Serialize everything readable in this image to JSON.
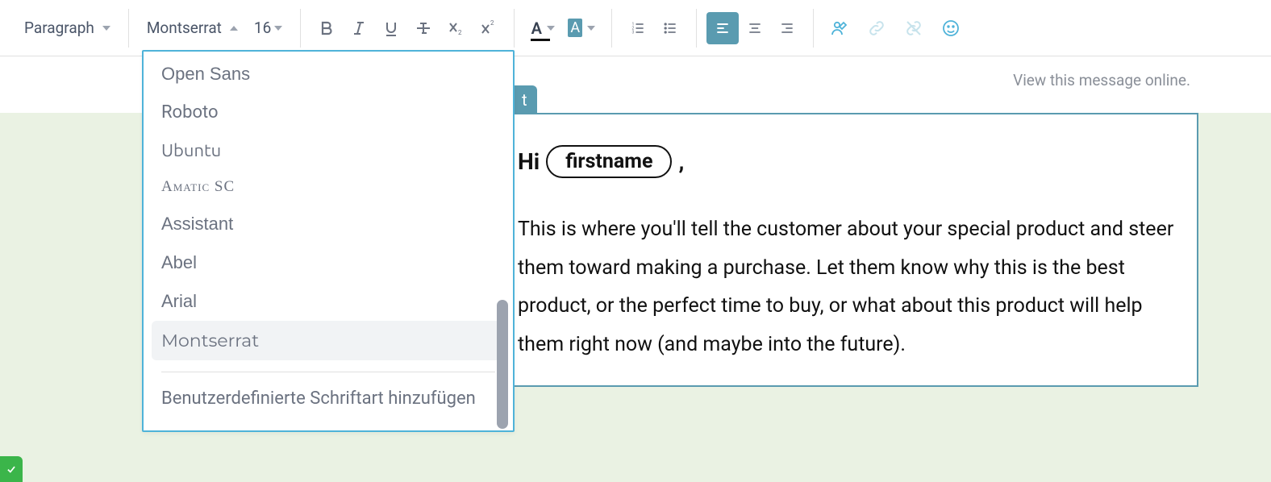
{
  "toolbar": {
    "paragraph": {
      "label": "Paragraph"
    },
    "font": {
      "label": "Montserrat"
    },
    "size": {
      "label": "16"
    }
  },
  "font_menu": {
    "items": [
      {
        "label": "Open Sans",
        "css": "ff-opensans"
      },
      {
        "label": "Roboto",
        "css": "ff-roboto"
      },
      {
        "label": "Ubuntu",
        "css": "ff-ubuntu"
      },
      {
        "label": "Amatic SC",
        "css": "ff-amatic"
      },
      {
        "label": "Assistant",
        "css": "ff-assistant"
      },
      {
        "label": "Abel",
        "css": "ff-abel"
      },
      {
        "label": "Arial",
        "css": "ff-arial"
      },
      {
        "label": "Montserrat",
        "css": "ff-montserrat",
        "selected": true
      }
    ],
    "custom_font_label": "Benutzerdefinierte Schriftart hinzufügen"
  },
  "header": {
    "view_online": "View this message online.",
    "edit_badge": "t"
  },
  "editor": {
    "greeting_prefix": "Hi",
    "greeting_token": "firstname",
    "greeting_suffix": ",",
    "body": "This is where you'll tell the customer about your special product and steer them toward making a purchase. Let them know why this is the best product, or the perfect time to buy, or what about this product will help them right now (and maybe into the future)."
  },
  "colors": {
    "accent": "#5a9bb0",
    "dropdown_border": "#4fb3d9",
    "bg_soft": "#eaf2e3",
    "green": "#3bb54a"
  }
}
